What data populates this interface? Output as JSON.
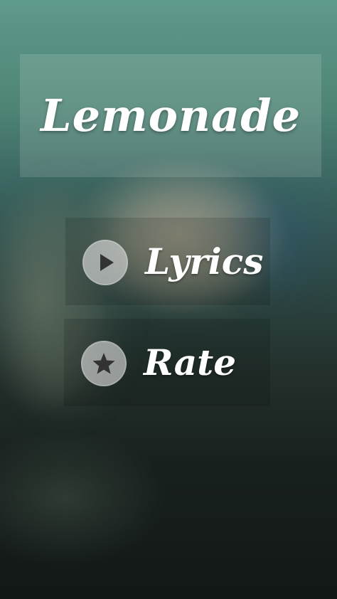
{
  "app": {
    "title": "Lemonade"
  },
  "menu": {
    "lyrics": {
      "label": "Lyrics",
      "icon": "play-icon"
    },
    "rate": {
      "label": "Rate",
      "icon": "star-icon"
    }
  },
  "colors": {
    "background_top": "#5f9a8c",
    "background_bottom": "#121816",
    "text": "#ffffff",
    "icon_circle": "#e1e1e1",
    "icon_glyph": "#333333"
  }
}
